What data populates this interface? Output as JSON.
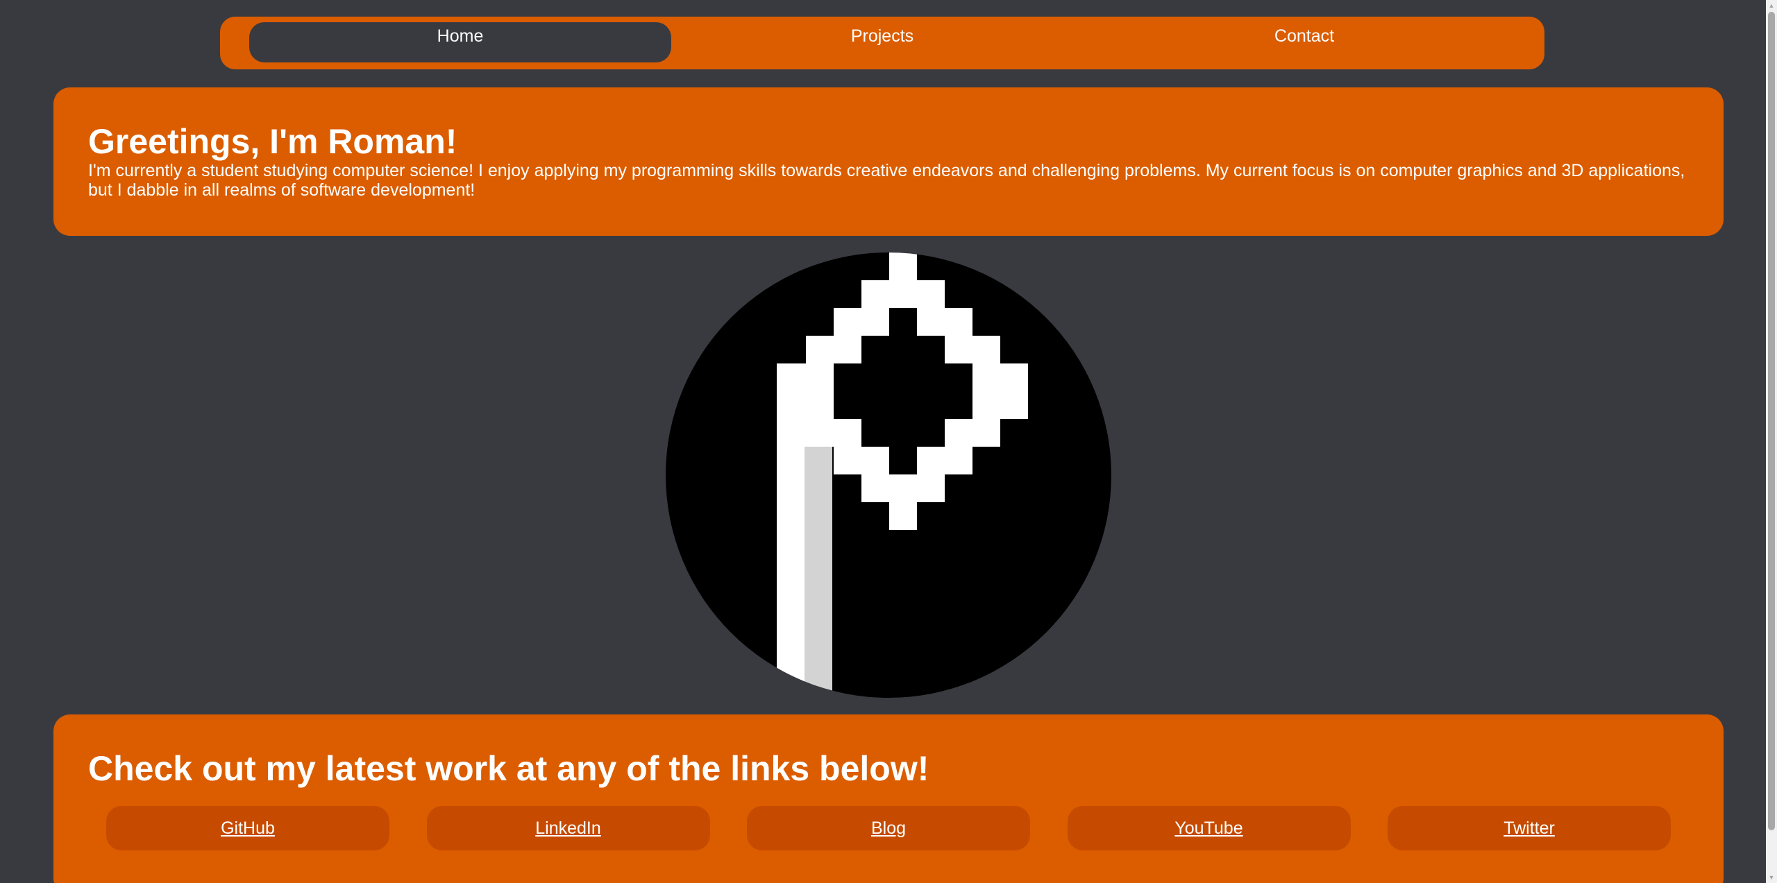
{
  "nav": {
    "tabs": [
      {
        "label": "Home",
        "active": true
      },
      {
        "label": "Projects",
        "active": false
      },
      {
        "label": "Contact",
        "active": false
      }
    ]
  },
  "intro": {
    "title": "Greetings, I'm Roman!",
    "body": "I'm currently a student studying computer science! I enjoy applying my programming skills towards creative endeavors and challenging problems. My current focus is on computer graphics and 3D applications, but I dabble in all realms of software development!"
  },
  "links": {
    "heading": "Check out my latest work at any of the links below!",
    "items": [
      {
        "label": "GitHub"
      },
      {
        "label": "LinkedIn"
      },
      {
        "label": "Blog"
      },
      {
        "label": "YouTube"
      },
      {
        "label": "Twitter"
      }
    ]
  },
  "logo": {
    "icon": "pixel-p-logo-icon"
  },
  "colors": {
    "background": "#393a40",
    "accent": "#db5d00",
    "button": "#c64b00",
    "text": "#ffffff"
  }
}
